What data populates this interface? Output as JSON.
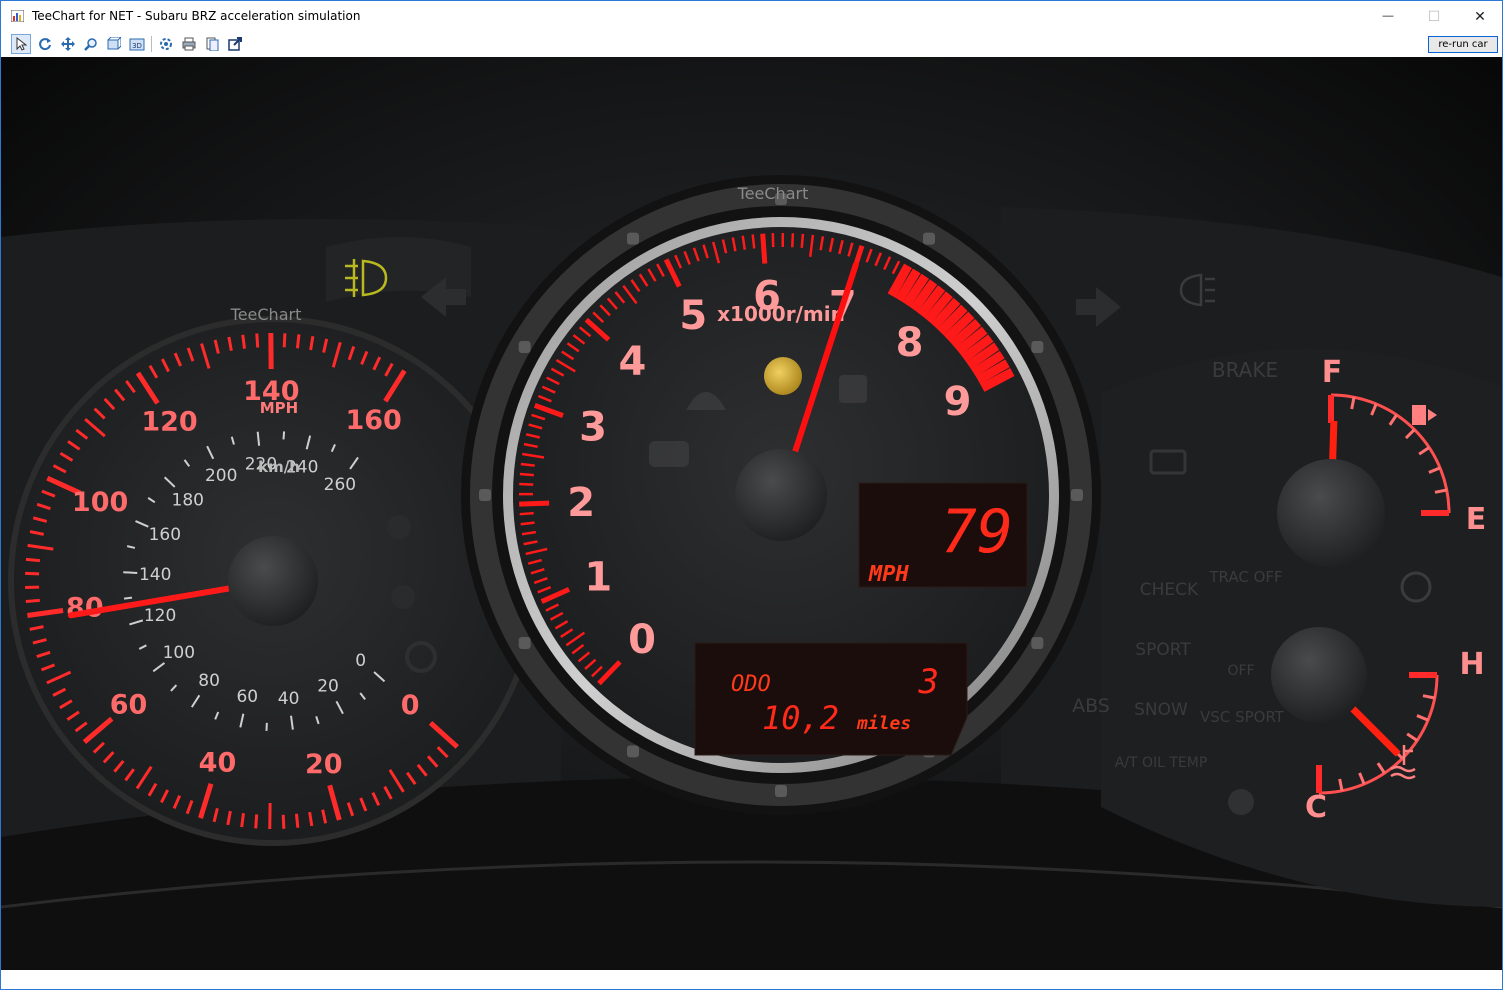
{
  "window": {
    "title": "TeeChart for NET - Subaru BRZ acceleration simulation",
    "minimize_glyph": "—",
    "maximize_glyph": "☐",
    "close_glyph": "✕"
  },
  "toolbar": {
    "buttons": [
      "pointer-icon",
      "rotate-icon",
      "move-icon",
      "zoom-icon",
      "depth-icon",
      "3d-icon",
      "edit-icon",
      "print-icon",
      "copy-icon",
      "export-icon"
    ],
    "rerun_label": "re-run car",
    "three_d_label": "3D"
  },
  "watermark": "TeeChart",
  "speedometer": {
    "mph_labels": [
      "20",
      "40",
      "60",
      "80",
      "100",
      "120",
      "140",
      "160"
    ],
    "zero_label": "0",
    "unit_mph": "MPH",
    "kmh_labels": [
      "20",
      "40",
      "60",
      "80",
      "100",
      "120",
      "140",
      "160",
      "180",
      "200",
      "220",
      "240",
      "260"
    ],
    "kmh_zero": "0",
    "unit_kmh": "km/h",
    "value_mph": 79
  },
  "tachometer": {
    "labels": [
      "0",
      "1",
      "2",
      "3",
      "4",
      "5",
      "6",
      "7",
      "8",
      "9"
    ],
    "unit": "x1000r/min",
    "value_krpm": 7.0,
    "redline_from_krpm": 7.5
  },
  "digital_speed": {
    "value": "79",
    "unit": "MPH"
  },
  "odometer": {
    "label": "ODO",
    "gear": "3",
    "distance": "10,2",
    "unit": "miles"
  },
  "fuel_gauge": {
    "full_label": "F",
    "empty_label": "E",
    "level_fraction": 0.98
  },
  "temp_gauge": {
    "hot_label": "H",
    "cold_label": "C",
    "level_fraction": 0.5
  },
  "indicators": {
    "brake": "BRAKE",
    "check": "CHECK",
    "trac_off": "TRAC OFF",
    "sport": "SPORT",
    "snow": "SNOW",
    "vsc_sport": "VSC SPORT",
    "abs": "ABS",
    "at_oil_temp": "A/T OIL TEMP",
    "off": "OFF"
  },
  "colors": {
    "accent_red": "#ff1a1a",
    "label_pink": "#ff8f8f",
    "window_border": "#2b79d4",
    "rerun_border": "#0a64d6"
  }
}
